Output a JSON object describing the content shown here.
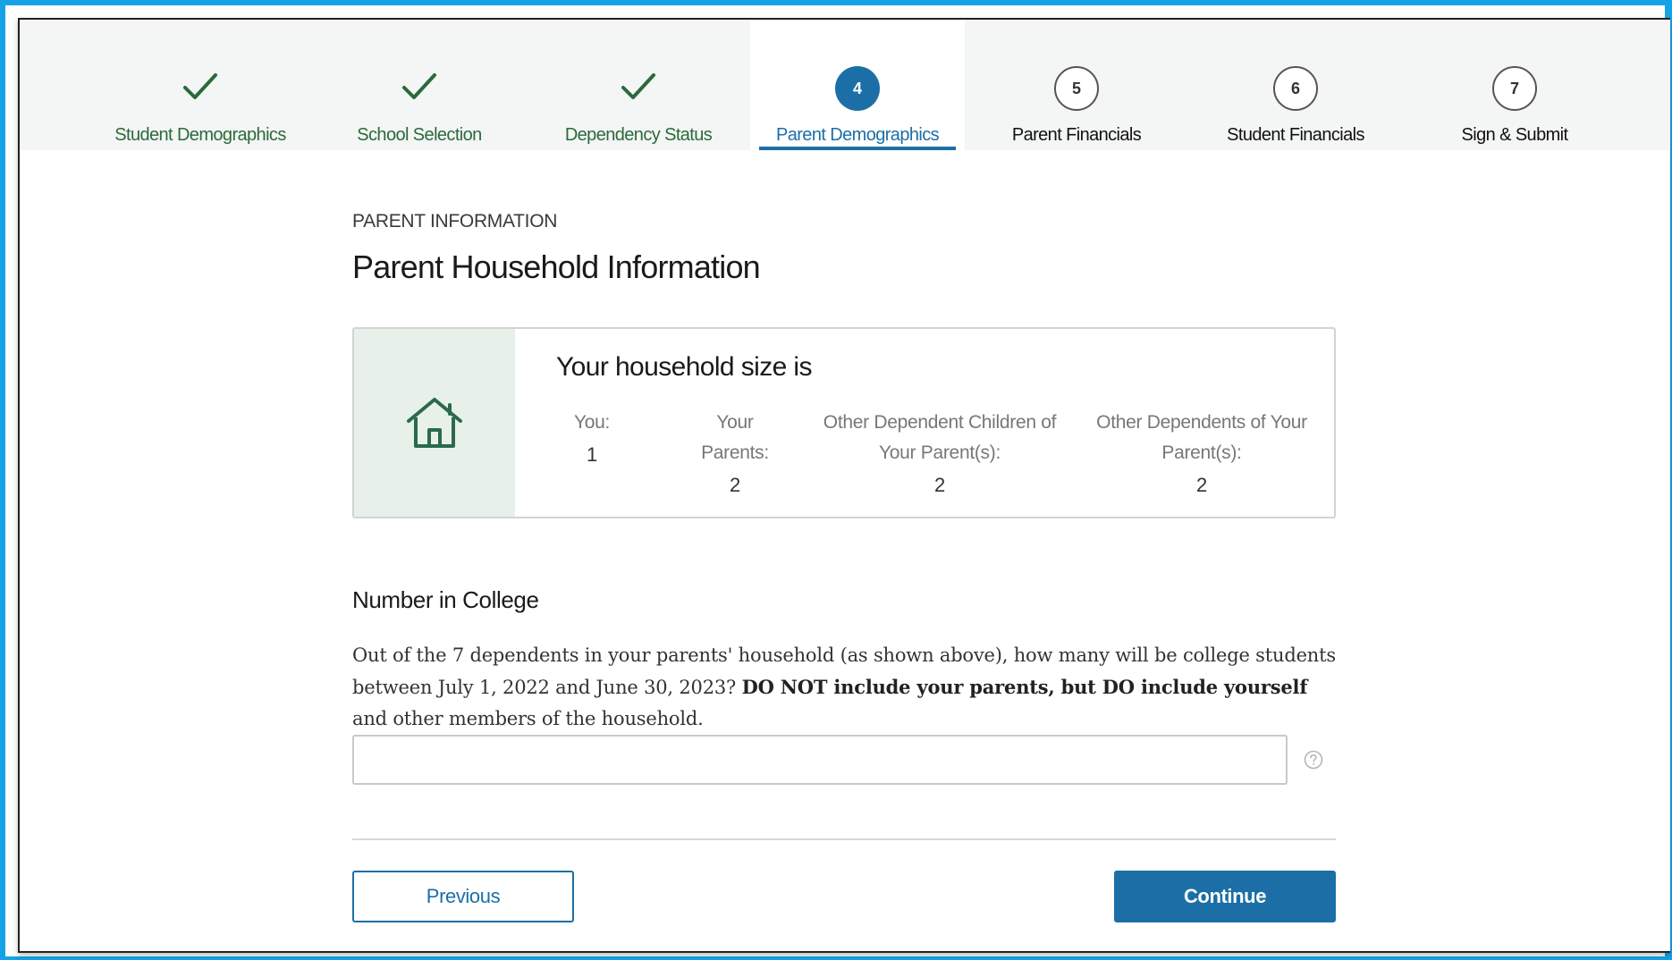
{
  "steps": [
    {
      "label": "Student Demographics",
      "state": "done"
    },
    {
      "label": "School Selection",
      "state": "done"
    },
    {
      "label": "Dependency Status",
      "state": "done"
    },
    {
      "label": "Parent Demographics",
      "state": "current",
      "number": "4"
    },
    {
      "label": "Parent Financials",
      "state": "pending",
      "number": "5"
    },
    {
      "label": "Student Financials",
      "state": "pending",
      "number": "6"
    },
    {
      "label": "Sign & Submit",
      "state": "pending",
      "number": "7"
    }
  ],
  "header": {
    "eyebrow": "PARENT INFORMATION",
    "title": "Parent Household Information"
  },
  "household": {
    "title": "Your household size is",
    "metrics": [
      {
        "label": "You:",
        "value": "1"
      },
      {
        "label": "Your Parents:",
        "value": "2"
      },
      {
        "label": "Other Dependent Children of Your Parent(s):",
        "value": "2"
      },
      {
        "label": "Other Dependents of Your Parent(s):",
        "value": "2"
      }
    ]
  },
  "college": {
    "section_title": "Number in College",
    "question_part1": "Out of the 7 dependents in your parents' household (as shown above), how many will be college students between July 1, 2022 and June 30, 2023? ",
    "question_bold": "DO NOT include your parents, but DO include yourself",
    "question_part2": " and other members of the household.",
    "input_value": "",
    "help_icon": "question-circle-icon"
  },
  "buttons": {
    "previous": "Previous",
    "continue": "Continue"
  },
  "colors": {
    "frame": "#16a3e6",
    "primary": "#1b6fa6",
    "done_green": "#2a6a3a",
    "house_panel": "#e8f0ea"
  }
}
